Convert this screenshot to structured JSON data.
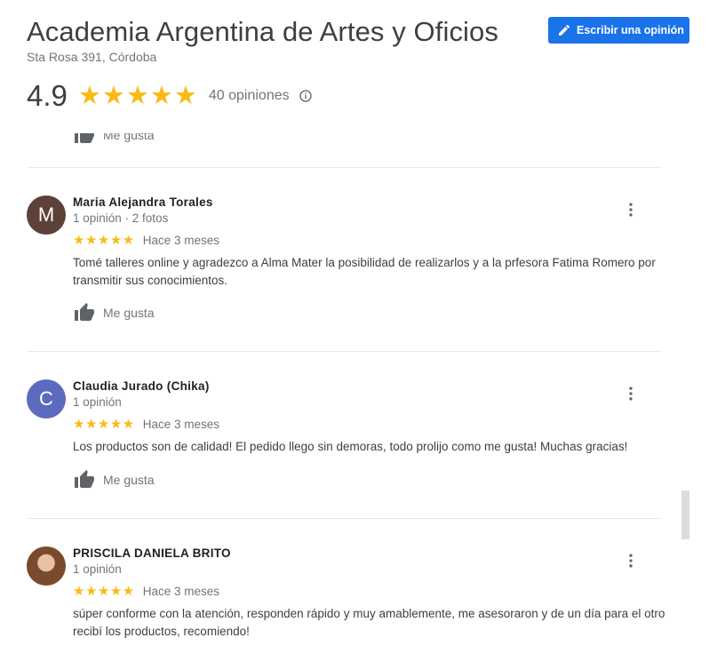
{
  "header": {
    "title": "Academia Argentina de Artes y Oficios",
    "address": "Sta Rosa 391, Córdoba",
    "write_review_label": "Escribir una opinión",
    "rating": "4.9",
    "stars": "★★★★★",
    "review_count": "40 opiniones"
  },
  "like_label": "Me gusta",
  "reviews": [
    {
      "name": "Maria Alejandra Torales",
      "initial": "M",
      "avatar_color": "#5d4037",
      "meta": "1 opinión · 2 fotos",
      "stars": "★★★★★",
      "time": "Hace 3 meses",
      "text": "Tomé talleres online y agradezco a Alma Mater la posibilidad de realizarlos y a la prfesora Fatima Romero por transmitir sus conocimientos."
    },
    {
      "name": "Claudia Jurado (Chika)",
      "initial": "C",
      "avatar_color": "#5c6bc0",
      "meta": "1 opinión",
      "stars": "★★★★★",
      "time": "Hace 3 meses",
      "text": "Los productos son de calidad! El pedido llego sin demoras, todo prolijo como me gusta! Muchas gracias!"
    },
    {
      "name": "PRISCILA DANIELA BRITO",
      "initial": "",
      "avatar_color": "#8d5a3b",
      "meta": "1 opinión",
      "stars": "★★★★★",
      "time": "Hace 3 meses",
      "text": "súper conforme con la atención, responden rápido y muy amablemente, me asesoraron y de un día para el otro recibí los productos, recomiendo!"
    }
  ],
  "colors": {
    "accent": "#1a73e8",
    "star": "#f9ba14"
  }
}
